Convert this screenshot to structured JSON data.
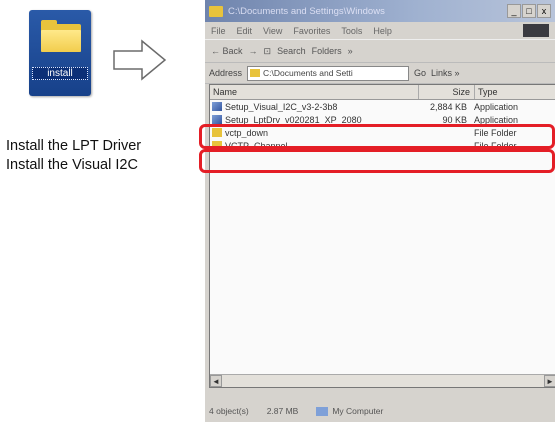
{
  "install_icon": {
    "label": "install",
    "icon": "folder-icon"
  },
  "arrow": {
    "icon": "arrow-right-icon"
  },
  "captions": [
    "Install the LPT Driver",
    "Install the Visual I2C"
  ],
  "window": {
    "title": "C:\\Documents and Settings\\Windows",
    "title_buttons": [
      "_",
      "□",
      "x"
    ],
    "menu": [
      "File",
      "Edit",
      "View",
      "Favorites",
      "Tools",
      "Help"
    ],
    "toolbar": [
      "← Back",
      "→",
      "⊡",
      "Search",
      "Folders",
      "»"
    ],
    "address_label": "Address",
    "address_value": "C:\\Documents and Setti",
    "go_label": "Go",
    "links_label": "Links »",
    "columns": {
      "name": "Name",
      "size": "Size",
      "type": "Type"
    },
    "rows": [
      {
        "name": "Setup_Visual_I2C_v3-2-3b8",
        "size": "2,884 KB",
        "type": "Application",
        "icon": "app"
      },
      {
        "name": "Setup_LptDrv_v020281_XP_2080",
        "size": "90 KB",
        "type": "Application",
        "icon": "app"
      },
      {
        "name": "vctp_down",
        "size": "",
        "type": "File Folder",
        "icon": "folder"
      },
      {
        "name": "VCTP_Channel",
        "size": "",
        "type": "File Folder",
        "icon": "folder"
      }
    ],
    "status": {
      "objects": "4 object(s)",
      "size": "2.87 MB",
      "location": "My Computer"
    }
  },
  "colors": {
    "highlight": "#e41e26",
    "icon_bg": "#2a5aa8",
    "folder": "#e8c33c"
  }
}
